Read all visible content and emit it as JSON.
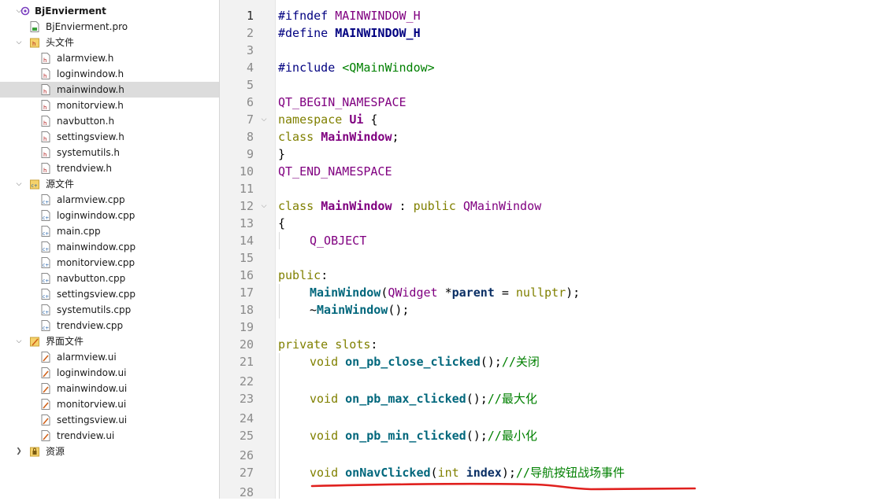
{
  "project_tree": {
    "root": {
      "label": "BjEnvierment"
    },
    "pro_file": {
      "label": "BjEnvierment.pro"
    },
    "headers": {
      "label": "头文件",
      "files": [
        "alarmview.h",
        "loginwindow.h",
        "mainwindow.h",
        "monitorview.h",
        "navbutton.h",
        "settingsview.h",
        "systemutils.h",
        "trendview.h"
      ]
    },
    "sources": {
      "label": "源文件",
      "files": [
        "alarmview.cpp",
        "loginwindow.cpp",
        "main.cpp",
        "mainwindow.cpp",
        "monitorview.cpp",
        "navbutton.cpp",
        "settingsview.cpp",
        "systemutils.cpp",
        "trendview.cpp"
      ]
    },
    "forms": {
      "label": "界面文件",
      "files": [
        "alarmview.ui",
        "loginwindow.ui",
        "mainwindow.ui",
        "monitorview.ui",
        "settingsview.ui",
        "trendview.ui"
      ]
    },
    "resources": {
      "label": "资源"
    },
    "selected_file": "mainwindow.h"
  },
  "editor": {
    "current_line": 1,
    "line_numbers": [
      "1",
      "2",
      "3",
      "4",
      "5",
      "6",
      "7",
      "8",
      "9",
      "10",
      "11",
      "12",
      "13",
      "14",
      "15",
      "16",
      "17",
      "18",
      "19",
      "20",
      "21",
      "22",
      "23",
      "24",
      "25",
      "26",
      "27",
      "28"
    ],
    "lines": {
      "l1": [
        "#ifndef ",
        "MAINWINDOW_H"
      ],
      "l2": [
        "#define ",
        "MAINWINDOW_H"
      ],
      "l4": [
        "#include ",
        "<QMainWindow>"
      ],
      "l6": [
        "QT_BEGIN_NAMESPACE"
      ],
      "l7": [
        "namespace ",
        "Ui",
        " {"
      ],
      "l8": [
        "class ",
        "MainWindow",
        ";"
      ],
      "l9": [
        "}"
      ],
      "l10": [
        "QT_END_NAMESPACE"
      ],
      "l12": [
        "class ",
        "MainWindow",
        " : ",
        "public ",
        "QMainWindow"
      ],
      "l13": [
        "{"
      ],
      "l14": [
        "Q_OBJECT"
      ],
      "l16": [
        "public",
        ":"
      ],
      "l17": [
        "MainWindow",
        "(",
        "QWidget",
        " *",
        "parent",
        " = ",
        "nullptr",
        ");"
      ],
      "l18": [
        "~",
        "MainWindow",
        "();"
      ],
      "l20": [
        "private slots",
        ":"
      ],
      "l21": [
        "void ",
        "on_pb_close_clicked",
        "();",
        "//关闭"
      ],
      "l23": [
        "void ",
        "on_pb_max_clicked",
        "();",
        "//最大化"
      ],
      "l25": [
        "void ",
        "on_pb_min_clicked",
        "();",
        "//最小化"
      ],
      "l27": [
        "void ",
        "onNavClicked",
        "(",
        "int ",
        "index",
        ");",
        "//导航按钮战场事件"
      ]
    },
    "annotation_color": "#e0201e"
  },
  "colors": {
    "keyword": "#808000",
    "macro": "#800080",
    "comment": "#008000",
    "function": "#00677c"
  }
}
